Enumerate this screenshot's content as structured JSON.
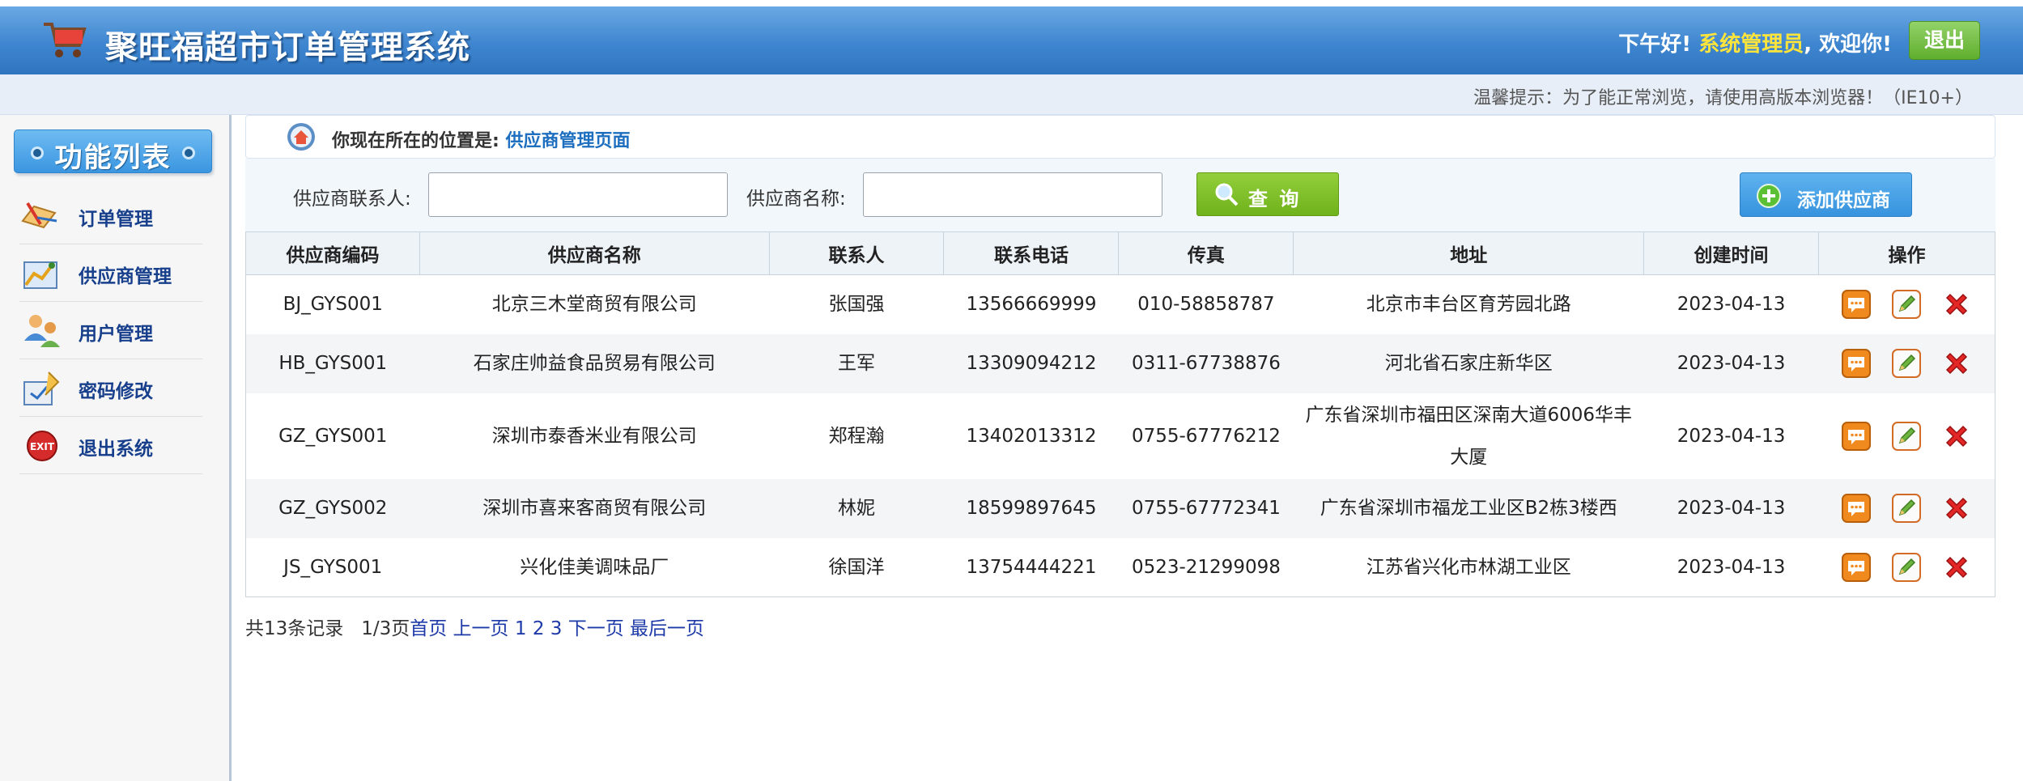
{
  "header": {
    "title": "聚旺福超市订单管理系统",
    "greeting_prefix": "下午好!",
    "user": "系统管理员",
    "greeting_suffix": ", 欢迎你!",
    "logout_label": "退出"
  },
  "notice": "温馨提示：为了能正常浏览，请使用高版本浏览器！（IE10+）",
  "sidebar": {
    "title": "功能列表",
    "items": [
      {
        "label": "订单管理",
        "icon": "order-icon"
      },
      {
        "label": "供应商管理",
        "icon": "supplier-icon"
      },
      {
        "label": "用户管理",
        "icon": "users-icon"
      },
      {
        "label": "密码修改",
        "icon": "password-icon"
      },
      {
        "label": "退出系统",
        "icon": "exit-icon"
      }
    ]
  },
  "breadcrumb": {
    "prefix": "你现在所在的位置是:",
    "current": "供应商管理页面"
  },
  "search": {
    "contact_label": "供应商联系人:",
    "contact_value": "",
    "name_label": "供应商名称:",
    "name_value": "",
    "query_label": "查 询",
    "add_label": "添加供应商"
  },
  "table": {
    "columns": [
      "供应商编码",
      "供应商名称",
      "联系人",
      "联系电话",
      "传真",
      "地址",
      "创建时间",
      "操作"
    ],
    "rows": [
      {
        "code": "BJ_GYS001",
        "name": "北京三木堂商贸有限公司",
        "contact": "张国强",
        "phone": "13566669999",
        "fax": "010-58858787",
        "address": "北京市丰台区育芳园北路",
        "created": "2023-04-13"
      },
      {
        "code": "HB_GYS001",
        "name": "石家庄帅益食品贸易有限公司",
        "contact": "王军",
        "phone": "13309094212",
        "fax": "0311-67738876",
        "address": "河北省石家庄新华区",
        "created": "2023-04-13"
      },
      {
        "code": "GZ_GYS001",
        "name": "深圳市泰香米业有限公司",
        "contact": "郑程瀚",
        "phone": "13402013312",
        "fax": "0755-67776212",
        "address": "广东省深圳市福田区深南大道6006华丰大厦",
        "created": "2023-04-13"
      },
      {
        "code": "GZ_GYS002",
        "name": "深圳市喜来客商贸有限公司",
        "contact": "林妮",
        "phone": "18599897645",
        "fax": "0755-67772341",
        "address": "广东省深圳市福龙工业区B2栋3楼西",
        "created": "2023-04-13"
      },
      {
        "code": "JS_GYS001",
        "name": "兴化佳美调味品厂",
        "contact": "徐国洋",
        "phone": "13754444221",
        "fax": "0523-21299098",
        "address": "江苏省兴化市林湖工业区",
        "created": "2023-04-13"
      }
    ]
  },
  "pager": {
    "total": "共13条记录",
    "page": "1/3页",
    "first": "首页",
    "prev": "上一页",
    "pages": [
      "1",
      "2",
      "3"
    ],
    "next": "下一页",
    "last": "最后一页"
  }
}
